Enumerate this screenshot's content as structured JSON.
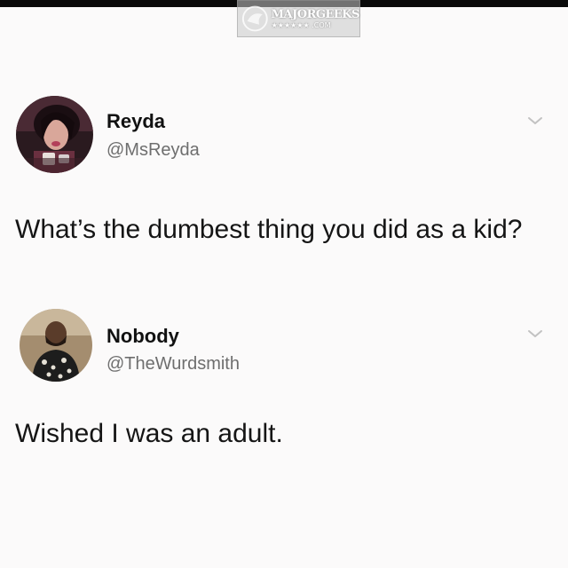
{
  "watermark": {
    "brand": "MAJORGEEKS",
    "suffix": "★★★★★★ .COM"
  },
  "tweets": [
    {
      "name": "Reyda",
      "handle": "@MsReyda",
      "text": "What’s the dumbest thing you did as a kid?",
      "avatar_icon": "profile-photo-icon"
    },
    {
      "name": "Nobody",
      "handle": "@TheWurdsmith",
      "text": "Wished I was an adult.",
      "avatar_icon": "profile-photo-icon"
    }
  ]
}
